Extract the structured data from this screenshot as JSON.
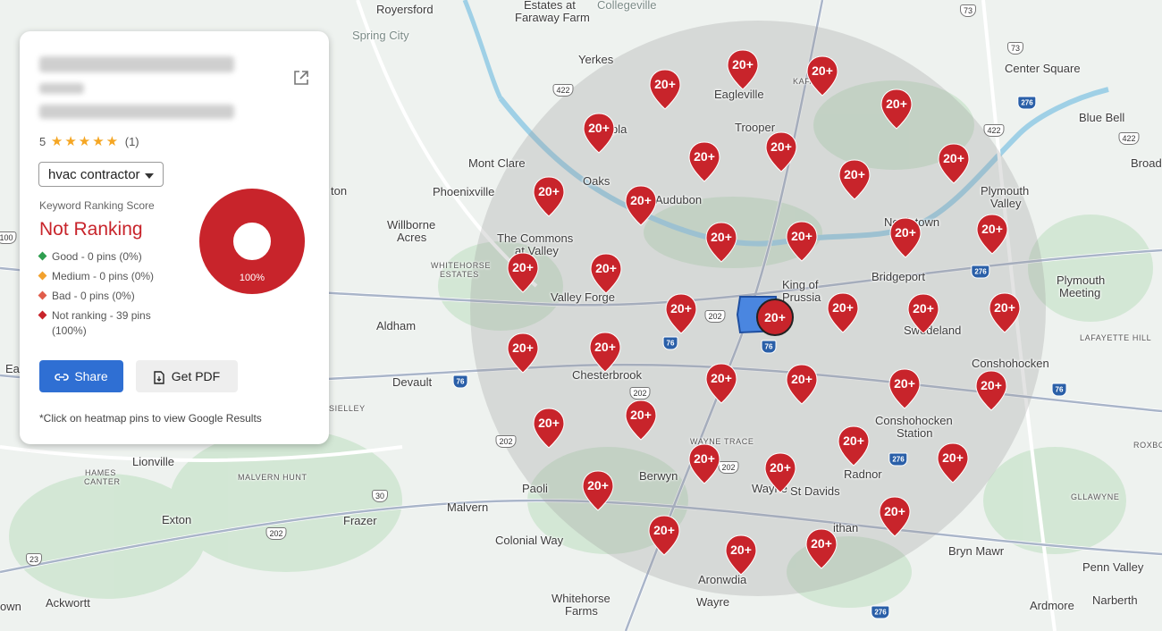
{
  "business": {
    "rating_value": "5",
    "rating_count": "(1)",
    "stars": 5
  },
  "keyword_dropdown": {
    "selected": "hvac contractor"
  },
  "score": {
    "label": "Keyword Ranking Score",
    "value": "Not Ranking",
    "donut_percent_label": "100%",
    "not_ranking_fraction": 1.0
  },
  "legend": [
    {
      "text": "Good - 0 pins (0%)",
      "color": "#2e9e4f"
    },
    {
      "text": "Medium - 0 pins (0%)",
      "color": "#f2a12e"
    },
    {
      "text": "Bad - 0 pins (0%)",
      "color": "#e05d4b"
    },
    {
      "text": "Not ranking - 39 pins (100%)",
      "color": "#c8242b"
    }
  ],
  "buttons": {
    "share": "Share",
    "pdf": "Get PDF"
  },
  "footnote": "*Click on heatmap pins to view Google Results",
  "colors": {
    "pin": "#c8242b",
    "accent": "#2f6fd3",
    "not_ranking": "#c8242b"
  },
  "pin_label": "20+",
  "center_pin_label": "20+",
  "places": {
    "royersford": "Royersford",
    "estates_faraway": "Estates at",
    "faraway_farm": "Faraway Farm",
    "collegeville": "Collegeville",
    "spring_city": "Spring City",
    "yerkes": "Yerkes",
    "eagleville": "Eagleville",
    "trooper": "Trooper",
    "center_square": "Center Square",
    "blue_bell": "Blue Bell",
    "broad": "Broad",
    "mont_clare": "Mont Clare",
    "oaks": "Oaks",
    "phoenixville": "Phoenixville",
    "audubon": "Audubon",
    "plymouth_valley_1": "Plymouth",
    "plymouth_valley_2": "Valley",
    "norristown": "Norristown",
    "willborne_acres_1": "Willborne",
    "willborne_acres_2": "Acres",
    "commons_1": "The Commons",
    "commons_2": "at Valley",
    "whitehorse_estates_1": "WHITEHORSE",
    "whitehorse_estates_2": "ESTATES",
    "valley_forge": "Valley Forge",
    "king_of_prussia_1": "King of",
    "king_of_prussia_2": "Prussia",
    "bridgeport": "Bridgeport",
    "plymouth_meeting_1": "Plymouth",
    "plymouth_meeting_2": "Meeting",
    "swedeland": "Swedeland",
    "aldham": "Aldham",
    "lafayette_hill": "LAFAYETTE HILL",
    "conshohocken": "Conshohocken",
    "chesterbrook": "Chesterbrook",
    "devault": "Devault",
    "conshohocken_station_1": "Conshohocken",
    "conshohocken_station_2": "Station",
    "wayne_trace": "WAYNE TRACE",
    "roxborough": "ROXBO",
    "lionville": "Lionville",
    "malvern_hunt": "MALVERN HUNT",
    "kimberton_1": "HAMES",
    "kimberton_2": "CANTER",
    "radnor": "Radnor",
    "berwyn": "Berwyn",
    "st_davids": "St Davids",
    "wayne": "Wayne",
    "paoli": "Paoli",
    "gladwyne": "GLLAWYNE",
    "exton": "Exton",
    "frazer": "Frazer",
    "malvern": "Malvern",
    "colonial_way": "Colonial Way",
    "ithan": "ithan",
    "bryn_mawr": "Bryn Mawr",
    "penn_valley": "Penn Valley",
    "narberth": "Narberth",
    "aronwdia": "Aronwdia",
    "whitehorse_farms_1": "Whitehorse",
    "whitehorse_farms_2": "Farms",
    "wayre": "Wayre",
    "ardmore": "Ardmore",
    "ackwortt": "Ackwortt",
    "own": "own",
    "ton": "ton",
    "ea": "Ea",
    "sielley": "SIELLEY",
    "ola": "pla",
    "ea2": "Ea",
    "kafayette": "KAFA",
    "we": "We"
  },
  "roads": [
    "422",
    "422",
    "422",
    "202",
    "202",
    "202",
    "202",
    "202",
    "30",
    "73",
    "73",
    "100",
    "276",
    "276",
    "276",
    "276",
    "76",
    "76",
    "76",
    "76",
    "23"
  ]
}
